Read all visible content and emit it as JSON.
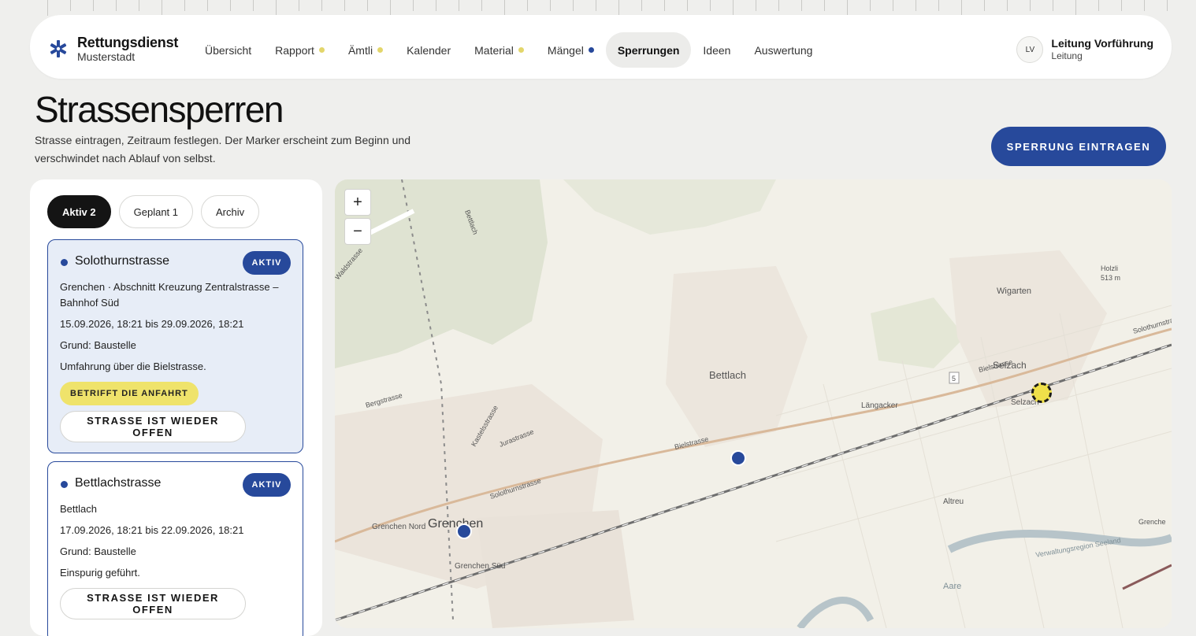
{
  "brand": {
    "name": "Rettungsdienst",
    "subtitle": "Musterstadt"
  },
  "nav": [
    {
      "label": "Übersicht",
      "dot": ""
    },
    {
      "label": "Rapport",
      "dot": "yellow"
    },
    {
      "label": "Ämtli",
      "dot": "yellow"
    },
    {
      "label": "Kalender",
      "dot": ""
    },
    {
      "label": "Material",
      "dot": "yellow"
    },
    {
      "label": "Mängel",
      "dot": "blue"
    },
    {
      "label": "Sperrungen",
      "dot": "",
      "active": true
    },
    {
      "label": "Ideen",
      "dot": ""
    },
    {
      "label": "Auswertung",
      "dot": ""
    }
  ],
  "user": {
    "initials": "LV",
    "name": "Leitung Vorführung",
    "role": "Leitung"
  },
  "page": {
    "title": "Strassensperren",
    "description": "Strasse eintragen, Zeitraum festlegen. Der Marker erscheint zum Beginn und verschwindet nach Ablauf von selbst.",
    "primary_button": "SPERRUNG EINTRAGEN"
  },
  "filters": [
    {
      "label": "Aktiv 2",
      "active": true
    },
    {
      "label": "Geplant 1",
      "active": false
    },
    {
      "label": "Archiv",
      "active": false
    }
  ],
  "closures": [
    {
      "title": "Solothurnstrasse",
      "status": "AKTIV",
      "location": "Grenchen · Abschnitt Kreuzung Zentralstrasse – Bahnhof Süd",
      "period": "15.09.2026, 18:21 bis 29.09.2026, 18:21",
      "reason": "Grund: Baustelle",
      "note": "Umfahrung über die Bielstrasse.",
      "warning": "BETRIFFT DIE ANFAHRT",
      "reopen_button": "STRASSE IST WIEDER OFFEN"
    },
    {
      "title": "Bettlachstrasse",
      "status": "AKTIV",
      "location": "Bettlach",
      "period": "17.09.2026, 18:21 bis 22.09.2026, 18:21",
      "reason": "Grund: Baustelle",
      "note": "Einspurig geführt.",
      "reopen_button": "STRASSE IST WIEDER OFFEN"
    }
  ],
  "map": {
    "zoom_in": "+",
    "zoom_out": "−",
    "labels": {
      "bettlach": "Bettlach",
      "grenchen": "Grenchen",
      "grenchen_nord": "Grenchen Nord",
      "grenchen_sued": "Grenchen Süd",
      "selzach": "Selzach",
      "selzach_station": "Selzach",
      "wigarten": "Wigarten",
      "holzli": "Holzli",
      "holzli_alt": "513 m",
      "laengacker": "Längacker",
      "altreu": "Altreu",
      "aare": "Aare",
      "bielstrasse": "Bielstrasse",
      "bielstrasse_east": "Bielstrasse",
      "solothurnstrasse": "Solothurnstrasse",
      "solothurnstrasse_east": "Solothurnstrasse",
      "bergstrasse": "Bergstrasse",
      "kastelsstrasse": "Kastelsstrasse",
      "jurastrasse": "Jurastrasse",
      "wald_strasse": "Waldstrasse",
      "bettlachberg": "Bettlach",
      "verwaltung": "Verwaltungsregion Seeland",
      "grenche_edge": "Grenche",
      "route_5": "5"
    }
  }
}
